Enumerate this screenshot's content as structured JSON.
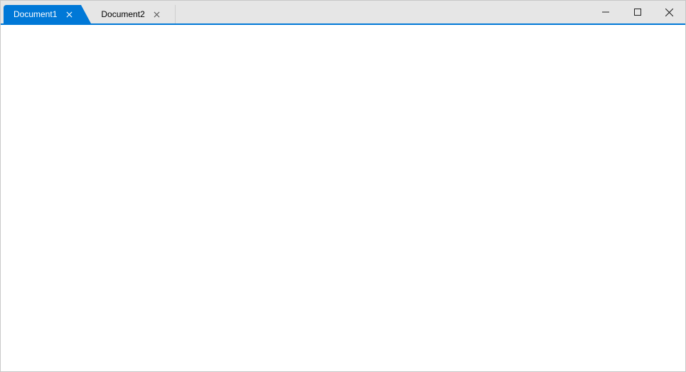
{
  "colors": {
    "accent": "#0078d7",
    "titlebar": "#e6e6e6"
  },
  "tabs": [
    {
      "label": "Document1",
      "active": true
    },
    {
      "label": "Document2",
      "active": false
    }
  ]
}
